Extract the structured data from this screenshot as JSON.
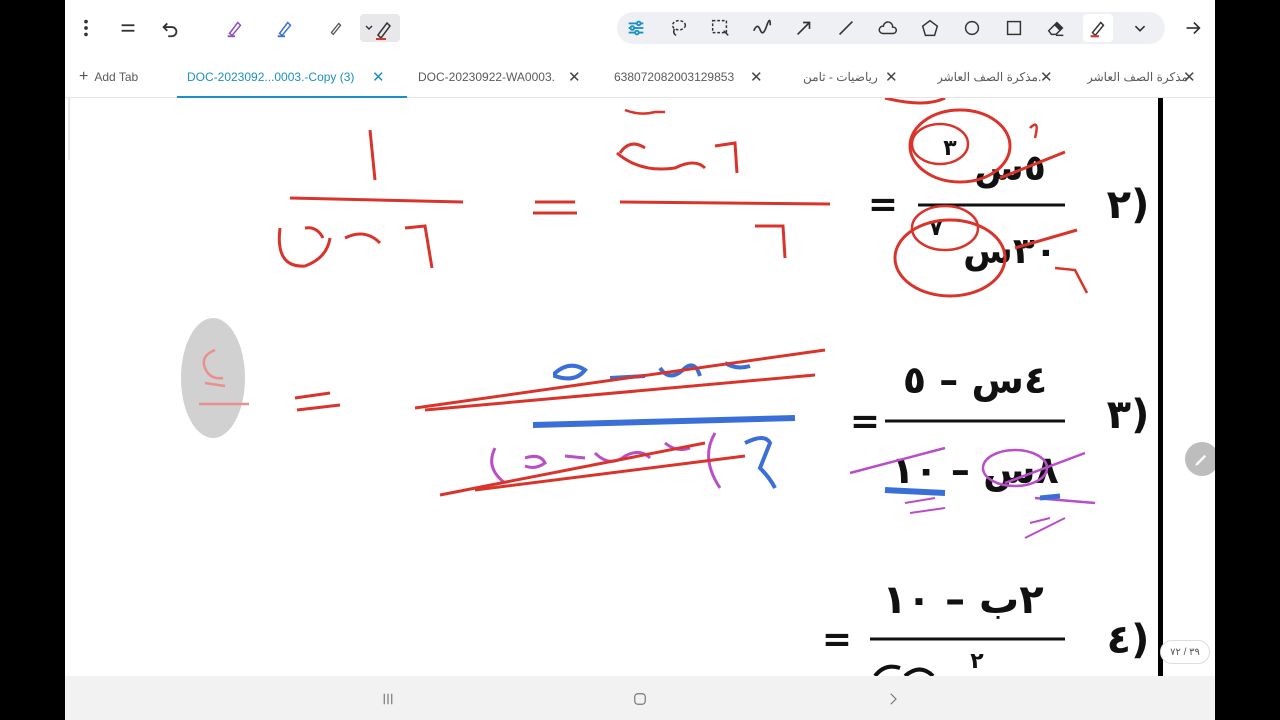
{
  "tabs": {
    "add_tab_label": "Add Tab",
    "items": [
      {
        "label": "DOC-2023092...0003.-Copy (3)",
        "active": true
      },
      {
        "label": "DOC-20230922-WA0003.",
        "active": false
      },
      {
        "label": "638072082003129853",
        "active": false
      },
      {
        "label": "رياضيات - ثامن",
        "active": false
      },
      {
        "label": "مذكرة الصف العاشر.",
        "active": false
      },
      {
        "label": "مذكرة الصف العاشر",
        "active": false
      }
    ],
    "close_glyph": "✕"
  },
  "page": {
    "indicator": "٣٩ / ٧٢"
  },
  "problems": [
    {
      "number": "٢)",
      "numerator_top": "٣",
      "numerator": "٥س",
      "denominator_top": "٧",
      "denominator": "٣٠س",
      "step_numerator": "١",
      "step_num_top": "س٤",
      "step_denominator": "٦",
      "result_numerator": "١",
      "result_denominator": "٦س٤"
    },
    {
      "number": "٣)",
      "numerator": "٤س – ٥",
      "denominator": "٨س – ١٠",
      "step_numerator": "٤س – ٥",
      "step_denominator": "٢(٤س – ٥)",
      "result": "٢"
    },
    {
      "number": "٤)",
      "numerator": "٢ب – ١٠",
      "denominator_partial": "٢"
    }
  ],
  "colors": {
    "accent": "#1a8fc8",
    "ink_red": "#d9342b",
    "ink_blue": "#3a6fd8",
    "ink_purple": "#b84fc8",
    "ink_black": "#111111",
    "highlighter": "#c9c9c9"
  },
  "icons": {
    "menu": "more-vertical-icon",
    "collapse": "equals-icon",
    "undo": "undo-icon",
    "pen_purple": "pen-icon",
    "pen_blue": "pen-icon",
    "pencil": "pencil-icon",
    "pen_red": "pen-icon",
    "settings": "sliders-icon",
    "lasso": "lasso-icon",
    "select": "select-rect-icon",
    "scribble": "scribble-icon",
    "arrow": "arrow-icon",
    "line": "line-icon",
    "cloud": "cloud-icon",
    "pentagon": "pentagon-icon",
    "circle": "circle-icon",
    "square": "square-icon",
    "eraser": "eraser-icon",
    "highlighter": "highlighter-icon",
    "chevron": "chevron-down-icon",
    "forward": "arrow-right-icon"
  }
}
